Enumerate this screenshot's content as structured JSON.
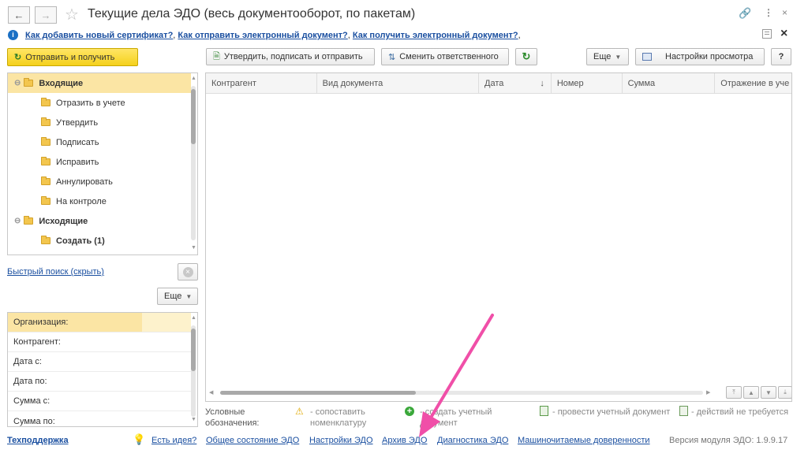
{
  "window": {
    "title": "Текущие дела ЭДО (весь документооборот, по пакетам)"
  },
  "help_links": [
    "Как добавить новый сертификат?",
    "Как отправить электронный документ?",
    "Как получить электронный документ?"
  ],
  "help_separator": ",",
  "toolbar": {
    "send_receive": "Отправить и получить",
    "approve_sign_send": "Утвердить, подписать и отправить",
    "change_responsible": "Сменить ответственного",
    "more": "Еще",
    "view_settings": "Настройки просмотра",
    "help": "?"
  },
  "tree": {
    "incoming": "Входящие",
    "incoming_items": [
      "Отразить в учете",
      "Утвердить",
      "Подписать",
      "Исправить",
      "Аннулировать",
      "На контроле"
    ],
    "outgoing": "Исходящие",
    "outgoing_items": [
      "Создать (1)"
    ]
  },
  "quick_search": "Быстрый поиск (скрыть)",
  "filter_more": "Еще",
  "filters": [
    "Организация:",
    "Контрагент:",
    "Дата с:",
    "Дата по:",
    "Сумма с:",
    "Сумма по:"
  ],
  "grid": {
    "columns": [
      "Контрагент",
      "Вид документа",
      "Дата",
      "Номер",
      "Сумма",
      "Отражение в уче"
    ],
    "sort_indicator": "↓"
  },
  "legend": {
    "title_line1": "Условные",
    "title_line2": "обозначения:",
    "item1_line1": "- сопоставить",
    "item1_line2": "номенклатуру",
    "item2_line1": "- создать учетный",
    "item2_line2": "документ",
    "item3": "- провести учетный документ",
    "item4": "- действий не требуется"
  },
  "footer": {
    "support": "Техподдержка",
    "idea": "Есть идея?",
    "general_state": "Общее состояние ЭДО",
    "settings": "Настройки ЭДО",
    "archive": "Архив ЭДО",
    "diagnostics": "Диагностика ЭДО",
    "proxies": "Машиночитаемые доверенности",
    "version": "Версия модуля ЭДО: 1.9.9.17"
  },
  "colors": {
    "accent_yellow": "#f5d11b",
    "link_blue": "#1a4fa0",
    "annotation_arrow": "#f04fa8"
  }
}
